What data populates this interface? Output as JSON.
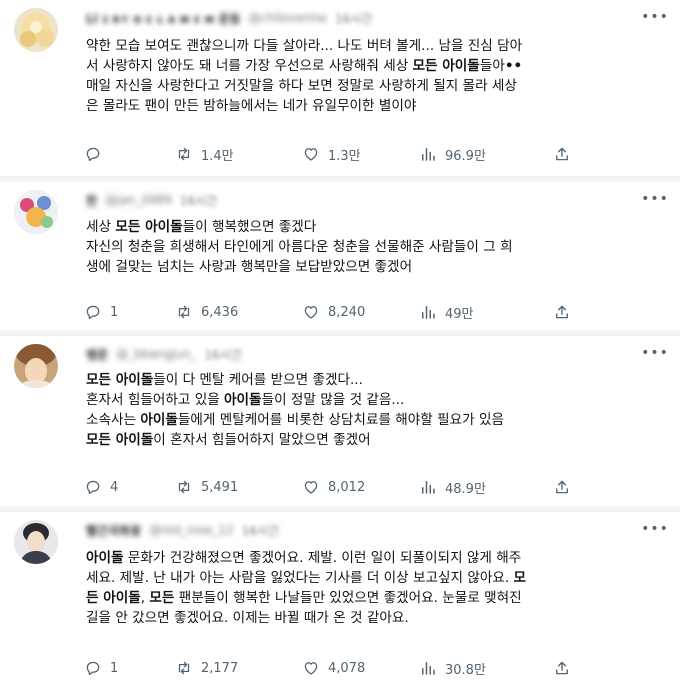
{
  "tweets": [
    {
      "author": {
        "name": "Ll ɪ ʀʏ ᴏ ᴄ ʟ ᴀ ᴍ ᴇ ᴍ 운동",
        "handle": "@chlloverme",
        "time": "16시간"
      },
      "lines": [
        [
          {
            "t": "약한 모습 보여도 괜찮으니까 다들 살아라... 나도 버텨 볼게... 남을 진심 담아"
          }
        ],
        [
          {
            "t": "서 사랑하지 않아도 돼 너를 가장 우선으로 사랑해줘 세상 "
          },
          {
            "t": "모든 아이돌",
            "b": true
          },
          {
            "t": "들아"
          },
          {
            "t": "••",
            "b": true
          }
        ],
        [
          {
            "t": "매일 자신을 사랑한다고 거짓말을 하다 보면 정말로 사랑하게 될지 몰라 세상"
          }
        ],
        [
          {
            "t": "은 몰라도 팬이 만든 밤하늘에서는 네가 유일무이한 별이야"
          }
        ]
      ],
      "counts": {
        "replies": "",
        "retweets": "1.4만",
        "likes": "1.3만",
        "views": "96.9만"
      }
    },
    {
      "author": {
        "name": "한",
        "handle": "@jan_0989",
        "time": "16시간"
      },
      "lines": [
        [
          {
            "t": "세상 "
          },
          {
            "t": "모든 아이돌",
            "b": true
          },
          {
            "t": "들이 행복했으면 좋겠다"
          }
        ],
        [
          {
            "t": "자신의 청춘을 희생해서 타인에게 아름다운 청춘을 선물해준 사람들이 그 희"
          }
        ],
        [
          {
            "t": "생에 걸맞는 넘치는 사랑과 행복만을 보답받았으면 좋겠어"
          }
        ]
      ],
      "counts": {
        "replies": "1",
        "retweets": "6,436",
        "likes": "8,240",
        "views": "49만"
      }
    },
    {
      "author": {
        "name": "뱅준",
        "handle": "@_bbangjun_",
        "time": "16시간"
      },
      "lines": [
        [
          {
            "t": "모든 아이돌",
            "b": true
          },
          {
            "t": "들이 다 멘탈 케어를 받으면 좋겠다..."
          }
        ],
        [
          {
            "t": "혼자서 힘들어하고 있을 "
          },
          {
            "t": "아이돌",
            "b": true
          },
          {
            "t": "들이 정말 많을 것 같음..."
          }
        ],
        [
          {
            "t": "소속사는 "
          },
          {
            "t": "아이돌",
            "b": true
          },
          {
            "t": "들에게 멘탈케어를 비롯한 상담치료를 해야할 필요가 있음"
          }
        ],
        [
          {
            "t": "모든 아이돌",
            "b": true
          },
          {
            "t": "이 혼자서 힘들어하지 말았으면 좋겠어"
          }
        ]
      ],
      "counts": {
        "replies": "4",
        "retweets": "5,491",
        "likes": "8,012",
        "views": "48.9만"
      }
    },
    {
      "author": {
        "name": "빨간국화꽃",
        "handle": "@red_rose_12",
        "time": "16시간"
      },
      "lines": [
        [
          {
            "t": "아이돌",
            "b": true
          },
          {
            "t": " 문화가 건강해졌으면 좋겠어요. 제발. 이런 일이 되풀이되지 않게 해주"
          }
        ],
        [
          {
            "t": "세요. 제발. 난 내가 아는 사람을 잃었다는 기사를 더 이상 보고싶지 않아요. "
          },
          {
            "t": "모",
            "b": true
          }
        ],
        [
          {
            "t": "든 아이돌",
            "b": true
          },
          {
            "t": ", "
          },
          {
            "t": "모든",
            "b": true
          },
          {
            "t": " 팬분들이 행복한 나날들만 있었으면 좋겠어요. 눈물로 맺혀진"
          }
        ],
        [
          {
            "t": "길을 안 갔으면 좋겠어요. 이제는 바뀔 때가 온 것 같아요."
          }
        ]
      ],
      "counts": {
        "replies": "1",
        "retweets": "2,177",
        "likes": "4,078",
        "views": "30.8만"
      }
    }
  ],
  "icons": {
    "reply": "reply-icon",
    "retweet": "retweet-icon",
    "like": "heart-icon",
    "views": "views-icon",
    "share": "share-icon",
    "more": "more-icon"
  },
  "colors": {
    "text": "#0f1419",
    "muted": "#536471",
    "separator": "#f1f3f4"
  }
}
